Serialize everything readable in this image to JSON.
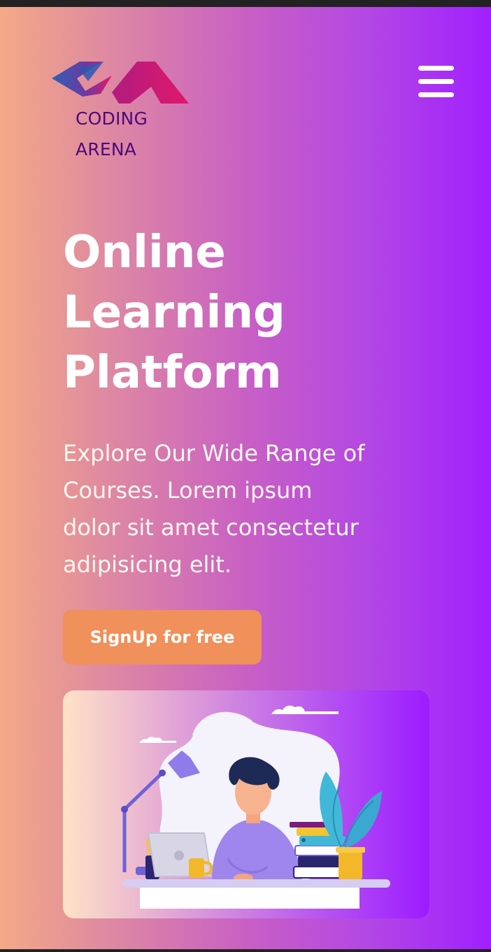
{
  "brand": {
    "name_line1": "CODING",
    "name_line2": "ARENA"
  },
  "header": {
    "menu_icon": "hamburger-menu-icon"
  },
  "hero": {
    "title_line1": "Online",
    "title_line2": "Learning",
    "title_line3": "Platform",
    "description_line1": "Explore Our Wide Range of",
    "description_line2": "Courses. Lorem ipsum",
    "description_line3": "dolor sit amet consectetur",
    "description_line4": "adipisicing elit.",
    "cta_label": "SignUp for free",
    "illustration": "student-studying-at-desk-illustration"
  },
  "colors": {
    "gradient_start": "#f4a986",
    "gradient_end": "#a01fff",
    "brand_text": "#4b0a7a",
    "cta_background": "#f0905a",
    "logo_blue": "#2e5db0",
    "logo_pink": "#e0196f"
  }
}
